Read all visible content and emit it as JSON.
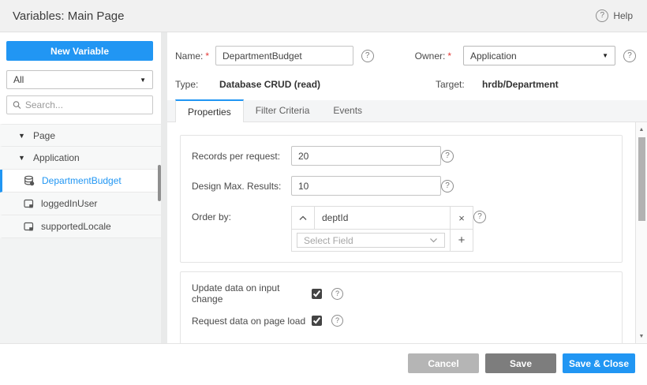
{
  "header": {
    "title": "Variables: Main Page",
    "help_label": "Help"
  },
  "sidebar": {
    "new_variable_button": "New Variable",
    "filter_dropdown_value": "All",
    "search_placeholder": "Search...",
    "tree": [
      {
        "label": "Page",
        "type": "group"
      },
      {
        "label": "Application",
        "type": "group"
      },
      {
        "label": "DepartmentBudget",
        "type": "variable",
        "selected": true,
        "icon": "database-variable-icon"
      },
      {
        "label": "loggedInUser",
        "type": "variable",
        "selected": false,
        "icon": "variable-icon"
      },
      {
        "label": "supportedLocale",
        "type": "variable",
        "selected": false,
        "icon": "variable-icon"
      }
    ]
  },
  "details": {
    "required_marker": "*",
    "name_label": "Name:",
    "name_value": "DepartmentBudget",
    "owner_label": "Owner:",
    "owner_value": "Application",
    "type_label": "Type:",
    "type_value": "Database CRUD (read)",
    "target_label": "Target:",
    "target_value": "hrdb/Department"
  },
  "tabs": [
    {
      "label": "Properties",
      "active": true
    },
    {
      "label": "Filter Criteria",
      "active": false
    },
    {
      "label": "Events",
      "active": false
    }
  ],
  "properties": {
    "records_per_request": {
      "label": "Records per request:",
      "value": "20"
    },
    "design_max_results": {
      "label": "Design Max. Results:",
      "value": "10"
    },
    "order_by": {
      "label": "Order by:",
      "field_value": "deptId",
      "select_placeholder": "Select Field"
    },
    "update_on_input": {
      "label": "Update data on input change",
      "checked": true
    },
    "request_on_load": {
      "label": "Request data on page load",
      "checked": true
    }
  },
  "footer": {
    "cancel_label": "Cancel",
    "save_label": "Save",
    "save_close_label": "Save & Close"
  },
  "icons": {
    "question": "?",
    "caret_down": "▼",
    "tree_collapse": "▼",
    "chevron_up": "⌃",
    "chevron_down": "⌄",
    "remove": "×",
    "add": "+",
    "scroll_up": "▲",
    "scroll_down": "▼"
  },
  "colors": {
    "accent": "#2196f3",
    "save_button": "#7d7d7d",
    "cancel_button": "#b5b5b5",
    "required": "#e53935"
  }
}
